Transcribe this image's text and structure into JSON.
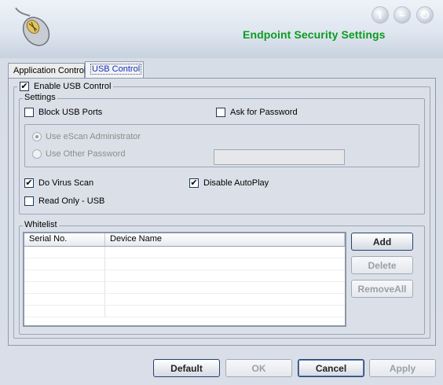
{
  "window": {
    "title": "Endpoint Security Settings"
  },
  "header": {
    "icons": [
      "info-icon",
      "minimize-icon",
      "power-icon"
    ]
  },
  "tabs": [
    {
      "label": "Application Control",
      "selected": false
    },
    {
      "label": "USB Control",
      "selected": true
    }
  ],
  "usb": {
    "enable_label": "Enable USB Control",
    "enable_checked": true,
    "settings": {
      "legend": "Settings",
      "block_usb_ports": {
        "label": "Block USB Ports",
        "checked": false
      },
      "ask_password": {
        "label": "Ask for Password",
        "checked": false
      },
      "use_escan_admin": {
        "label": "Use eScan Administrator",
        "selected": true,
        "disabled": true
      },
      "use_other_password": {
        "label": "Use Other Password",
        "selected": false,
        "disabled": true
      },
      "password_value": "",
      "do_virus_scan": {
        "label": "Do Virus Scan",
        "checked": true
      },
      "disable_autoplay": {
        "label": "Disable AutoPlay",
        "checked": true
      },
      "read_only_usb": {
        "label": "Read Only - USB",
        "checked": false
      }
    },
    "whitelist": {
      "legend": "Whitelist",
      "columns": [
        "Serial No.",
        "Device Name"
      ],
      "rows": [],
      "buttons": {
        "add": "Add",
        "delete": "Delete",
        "remove_all": "RemoveAll"
      }
    }
  },
  "footer": {
    "default": "Default",
    "ok": "OK",
    "cancel": "Cancel",
    "apply": "Apply"
  },
  "colors": {
    "title_green": "#0b9c1f",
    "tab_selected_text": "#1d2bb3"
  }
}
